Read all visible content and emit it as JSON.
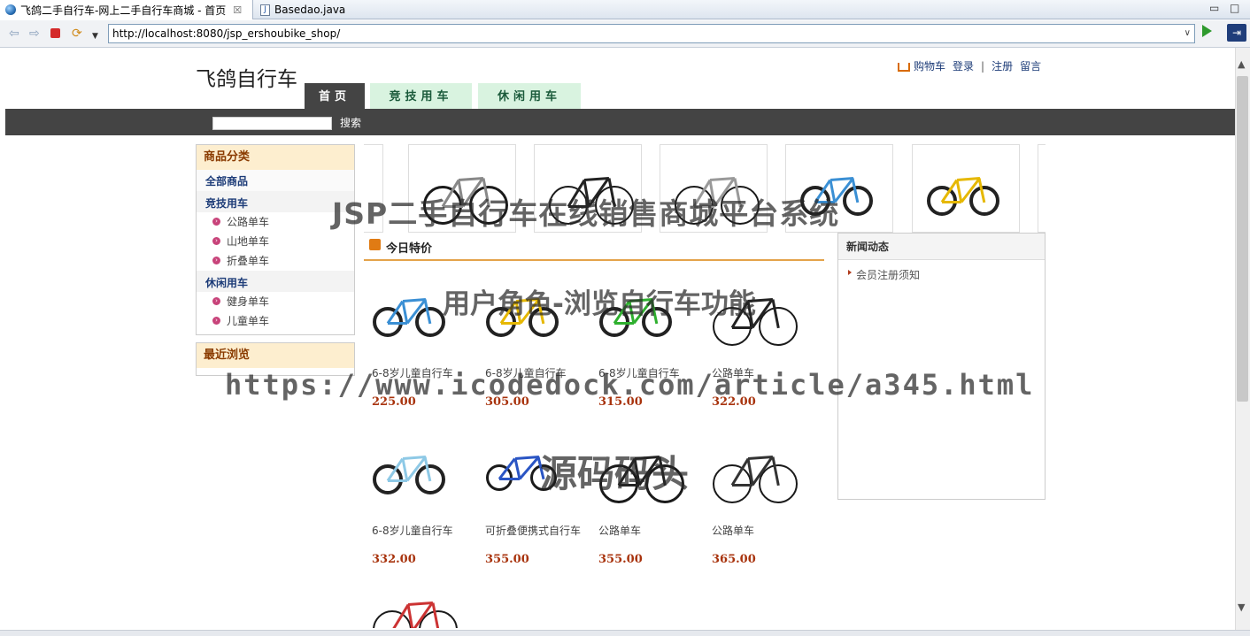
{
  "browser": {
    "tabs": [
      {
        "title": "飞鸽二手自行车-网上二手自行车商城 - 首页"
      },
      {
        "title": "Basedao.java"
      }
    ],
    "close_glyph": "☒",
    "url": "http://localhost:8080/jsp_ershoubike_shop/"
  },
  "header": {
    "logo": "飞鸽自行车",
    "links": {
      "cart": "购物车",
      "login": "登录",
      "sep": "|",
      "register": "注册",
      "message": "留言"
    }
  },
  "nav": {
    "tabs": [
      "首页",
      "竞技用车",
      "休闲用车"
    ],
    "search_button": "搜索",
    "search_value": ""
  },
  "sidebar": {
    "category_title": "商品分类",
    "all": "全部商品",
    "groups": [
      {
        "name": "竞技用车",
        "items": [
          "公路单车",
          "山地单车",
          "折叠单车"
        ]
      },
      {
        "name": "休闲用车",
        "items": [
          "健身单车",
          "儿童单车"
        ]
      }
    ],
    "recent_title": "最近浏览"
  },
  "special": {
    "title": "今日特价",
    "products": [
      {
        "name": "6-8岁儿童自行车",
        "price": "225.00",
        "color": "#3a8fd4",
        "kind": "kid"
      },
      {
        "name": "6-8岁儿童自行车",
        "price": "305.00",
        "color": "#e6b800",
        "kind": "kid"
      },
      {
        "name": "6-8岁儿童自行车",
        "price": "315.00",
        "color": "#2fb02f",
        "kind": "kid"
      },
      {
        "name": "公路单车",
        "price": "322.00",
        "color": "#222222",
        "kind": "road"
      },
      {
        "name": "6-8岁儿童自行车",
        "price": "332.00",
        "color": "#8ec9e6",
        "kind": "kid"
      },
      {
        "name": "可折叠便携式自行车",
        "price": "355.00",
        "color": "#2a55c4",
        "kind": "fold"
      },
      {
        "name": "公路单车",
        "price": "355.00",
        "color": "#222222",
        "kind": "mtb"
      },
      {
        "name": "公路单车",
        "price": "365.00",
        "color": "#333333",
        "kind": "road"
      }
    ]
  },
  "news": {
    "title": "新闻动态",
    "items": [
      "会员注册须知"
    ]
  },
  "watermark": {
    "line1": "JSP二手自行车在线销售商城平台系统",
    "line2": "用户角色-浏览自行车功能",
    "line3": "https://www.icodedock.com/article/a345.html",
    "line4": "源码码头"
  }
}
